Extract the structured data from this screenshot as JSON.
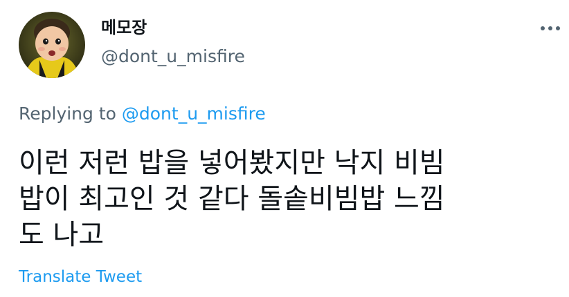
{
  "tweet": {
    "author": {
      "display_name": "메모장",
      "handle": "@dont_u_misfire",
      "avatar_icon": "profile-photo-child"
    },
    "more_icon": "more-dots-icon",
    "reply_context": {
      "prefix": "Replying to ",
      "mention": "@dont_u_misfire"
    },
    "text_lines": [
      "이런 저런 밥을 넣어봤지만 낙지 비빔",
      "밥이 최고인 것 같다 돌솥비빔밥 느낌",
      "도 나고"
    ],
    "translate_label": "Translate Tweet"
  },
  "colors": {
    "text_primary": "#0f1419",
    "text_secondary": "#536471",
    "link": "#1d9bf0",
    "background": "#ffffff"
  }
}
